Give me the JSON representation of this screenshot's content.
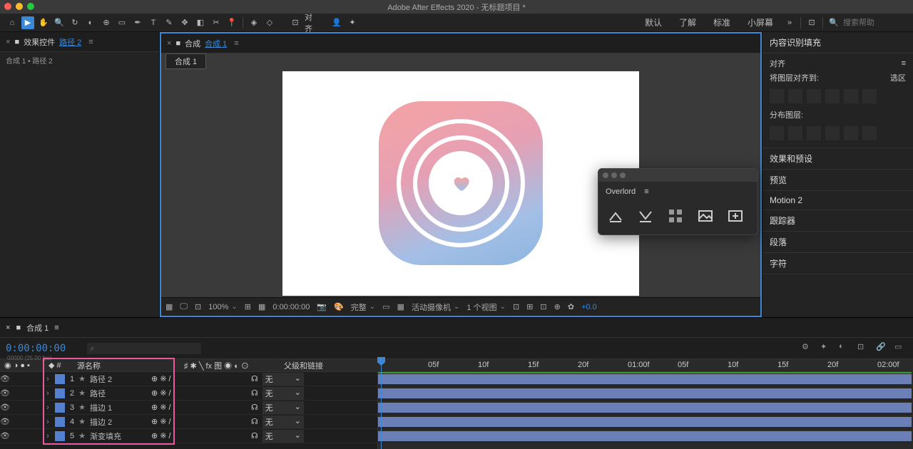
{
  "title": "Adobe After Effects 2020 - 无标题项目 *",
  "toolbar": {
    "workspaces": [
      "默认",
      "了解",
      "标准",
      "小屏幕"
    ],
    "search_placeholder": "搜索帮助"
  },
  "left": {
    "tab_label": "效果控件",
    "active_item": "路径 2",
    "breadcrumb": "合成 1 • 路径 2"
  },
  "center": {
    "tab_prefix": "合成",
    "tab_active": "合成 1",
    "viewer_tab": "合成 1",
    "footer": {
      "zoom": "100%",
      "time": "0:00:00:00",
      "quality": "完整",
      "camera": "活动摄像机",
      "views": "1 个视图",
      "adjust": "+0.0"
    }
  },
  "overlord": {
    "title": "Overlord"
  },
  "right": {
    "sections": [
      "内容识别填充",
      "对齐",
      "效果和预设",
      "预览",
      "Motion 2",
      "跟踪器",
      "段落",
      "字符"
    ],
    "align_label": "将图层对齐到:",
    "align_value": "选区",
    "distribute_label": "分布图层:"
  },
  "timeline": {
    "tab": "合成 1",
    "timecode": "0:00:00:00",
    "fps": "00000 (25.00 fps)",
    "search_placeholder": "⌕",
    "col_source": "源名称",
    "col_mode": "♯ ✱ ╲ fx 图 ◉ ◐ ⊙",
    "col_parent": "父级和链接",
    "layers": [
      {
        "num": "1",
        "name": "路径 2",
        "parent": "无"
      },
      {
        "num": "2",
        "name": "路径",
        "parent": "无"
      },
      {
        "num": "3",
        "name": "描边 1",
        "parent": "无"
      },
      {
        "num": "4",
        "name": "描边 2",
        "parent": "无"
      },
      {
        "num": "5",
        "name": "渐变填充",
        "parent": "无"
      }
    ],
    "ticks": [
      "05f",
      "10f",
      "15f",
      "20f",
      "01:00f",
      "05f",
      "10f",
      "15f",
      "20f",
      "02:00f"
    ]
  }
}
